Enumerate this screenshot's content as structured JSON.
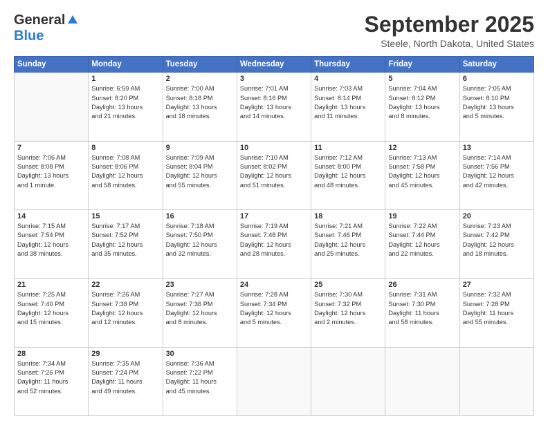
{
  "logo": {
    "general": "General",
    "blue": "Blue"
  },
  "title": "September 2025",
  "location": "Steele, North Dakota, United States",
  "days_header": [
    "Sunday",
    "Monday",
    "Tuesday",
    "Wednesday",
    "Thursday",
    "Friday",
    "Saturday"
  ],
  "weeks": [
    [
      {
        "num": "",
        "info": ""
      },
      {
        "num": "1",
        "info": "Sunrise: 6:59 AM\nSunset: 8:20 PM\nDaylight: 13 hours\nand 21 minutes."
      },
      {
        "num": "2",
        "info": "Sunrise: 7:00 AM\nSunset: 8:18 PM\nDaylight: 13 hours\nand 18 minutes."
      },
      {
        "num": "3",
        "info": "Sunrise: 7:01 AM\nSunset: 8:16 PM\nDaylight: 13 hours\nand 14 minutes."
      },
      {
        "num": "4",
        "info": "Sunrise: 7:03 AM\nSunset: 8:14 PM\nDaylight: 13 hours\nand 11 minutes."
      },
      {
        "num": "5",
        "info": "Sunrise: 7:04 AM\nSunset: 8:12 PM\nDaylight: 13 hours\nand 8 minutes."
      },
      {
        "num": "6",
        "info": "Sunrise: 7:05 AM\nSunset: 8:10 PM\nDaylight: 13 hours\nand 5 minutes."
      }
    ],
    [
      {
        "num": "7",
        "info": "Sunrise: 7:06 AM\nSunset: 8:08 PM\nDaylight: 13 hours\nand 1 minute."
      },
      {
        "num": "8",
        "info": "Sunrise: 7:08 AM\nSunset: 8:06 PM\nDaylight: 12 hours\nand 58 minutes."
      },
      {
        "num": "9",
        "info": "Sunrise: 7:09 AM\nSunset: 8:04 PM\nDaylight: 12 hours\nand 55 minutes."
      },
      {
        "num": "10",
        "info": "Sunrise: 7:10 AM\nSunset: 8:02 PM\nDaylight: 12 hours\nand 51 minutes."
      },
      {
        "num": "11",
        "info": "Sunrise: 7:12 AM\nSunset: 8:00 PM\nDaylight: 12 hours\nand 48 minutes."
      },
      {
        "num": "12",
        "info": "Sunrise: 7:13 AM\nSunset: 7:58 PM\nDaylight: 12 hours\nand 45 minutes."
      },
      {
        "num": "13",
        "info": "Sunrise: 7:14 AM\nSunset: 7:56 PM\nDaylight: 12 hours\nand 42 minutes."
      }
    ],
    [
      {
        "num": "14",
        "info": "Sunrise: 7:15 AM\nSunset: 7:54 PM\nDaylight: 12 hours\nand 38 minutes."
      },
      {
        "num": "15",
        "info": "Sunrise: 7:17 AM\nSunset: 7:52 PM\nDaylight: 12 hours\nand 35 minutes."
      },
      {
        "num": "16",
        "info": "Sunrise: 7:18 AM\nSunset: 7:50 PM\nDaylight: 12 hours\nand 32 minutes."
      },
      {
        "num": "17",
        "info": "Sunrise: 7:19 AM\nSunset: 7:48 PM\nDaylight: 12 hours\nand 28 minutes."
      },
      {
        "num": "18",
        "info": "Sunrise: 7:21 AM\nSunset: 7:46 PM\nDaylight: 12 hours\nand 25 minutes."
      },
      {
        "num": "19",
        "info": "Sunrise: 7:22 AM\nSunset: 7:44 PM\nDaylight: 12 hours\nand 22 minutes."
      },
      {
        "num": "20",
        "info": "Sunrise: 7:23 AM\nSunset: 7:42 PM\nDaylight: 12 hours\nand 18 minutes."
      }
    ],
    [
      {
        "num": "21",
        "info": "Sunrise: 7:25 AM\nSunset: 7:40 PM\nDaylight: 12 hours\nand 15 minutes."
      },
      {
        "num": "22",
        "info": "Sunrise: 7:26 AM\nSunset: 7:38 PM\nDaylight: 12 hours\nand 12 minutes."
      },
      {
        "num": "23",
        "info": "Sunrise: 7:27 AM\nSunset: 7:36 PM\nDaylight: 12 hours\nand 8 minutes."
      },
      {
        "num": "24",
        "info": "Sunrise: 7:28 AM\nSunset: 7:34 PM\nDaylight: 12 hours\nand 5 minutes."
      },
      {
        "num": "25",
        "info": "Sunrise: 7:30 AM\nSunset: 7:32 PM\nDaylight: 12 hours\nand 2 minutes."
      },
      {
        "num": "26",
        "info": "Sunrise: 7:31 AM\nSunset: 7:30 PM\nDaylight: 11 hours\nand 58 minutes."
      },
      {
        "num": "27",
        "info": "Sunrise: 7:32 AM\nSunset: 7:28 PM\nDaylight: 11 hours\nand 55 minutes."
      }
    ],
    [
      {
        "num": "28",
        "info": "Sunrise: 7:34 AM\nSunset: 7:26 PM\nDaylight: 11 hours\nand 52 minutes."
      },
      {
        "num": "29",
        "info": "Sunrise: 7:35 AM\nSunset: 7:24 PM\nDaylight: 11 hours\nand 49 minutes."
      },
      {
        "num": "30",
        "info": "Sunrise: 7:36 AM\nSunset: 7:22 PM\nDaylight: 11 hours\nand 45 minutes."
      },
      {
        "num": "",
        "info": ""
      },
      {
        "num": "",
        "info": ""
      },
      {
        "num": "",
        "info": ""
      },
      {
        "num": "",
        "info": ""
      }
    ]
  ]
}
